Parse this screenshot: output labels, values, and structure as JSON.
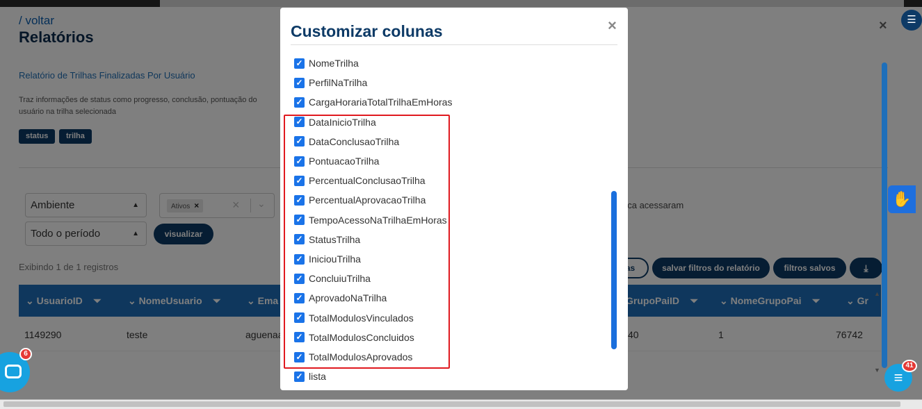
{
  "page": {
    "back_link": "/ voltar",
    "title": "Relatórios",
    "report_name": "Relatório de Trilhas Finalizadas Por Usuário",
    "report_description": "Traz informações de status como progresso, conclusão, pontuação do usuário na trilha selecionada",
    "tags": [
      "status",
      "trilha"
    ]
  },
  "filters": {
    "ambiente": "Ambiente",
    "periodo": "Todo o período",
    "chip_label": "Ativos",
    "visualizar_label": "visualizar",
    "nunca_text": "nca acessaram"
  },
  "actions": {
    "partial_btn": "as",
    "salvar_label": "salvar filtros do relatório",
    "salvos_label": "filtros salvos"
  },
  "table": {
    "records_text": "Exibindo 1 de 1 registros",
    "headers": [
      "UsuarioID",
      "NomeUsuario",
      "Ema",
      "GrupoPaiID",
      "NomeGrupoPai",
      "Gr"
    ],
    "row": [
      "1149290",
      "teste",
      "aguenaa",
      "40",
      "1",
      "76742"
    ]
  },
  "modal": {
    "title": "Customizar colunas",
    "close": "×",
    "columns": [
      "NomeTrilha",
      "PerfilNaTrilha",
      "CargaHorariaTotalTrilhaEmHoras",
      "DataInicioTrilha",
      "DataConclusaoTrilha",
      "PontuacaoTrilha",
      "PercentualConclusaoTrilha",
      "PercentualAprovacaoTrilha",
      "TempoAcessoNaTrilhaEmHoras",
      "StatusTrilha",
      "IniciouTrilha",
      "ConcluiuTrilha",
      "AprovadoNaTrilha",
      "TotalModulosVinculados",
      "TotalModulosConcluidos",
      "TotalModulosAprovados",
      "lista"
    ]
  },
  "badges": {
    "chat_left": "6",
    "chat_right": "41"
  },
  "colors": {
    "primary": "#0d3a66",
    "accent": "#1e6fba",
    "highlight": "#e0191f",
    "checkbox": "#1a73e8"
  },
  "icons": [
    "close-icon",
    "filter-icon",
    "chevron-down-icon",
    "download-icon",
    "chat-icon",
    "accessibility-icon",
    "menu-icon"
  ]
}
